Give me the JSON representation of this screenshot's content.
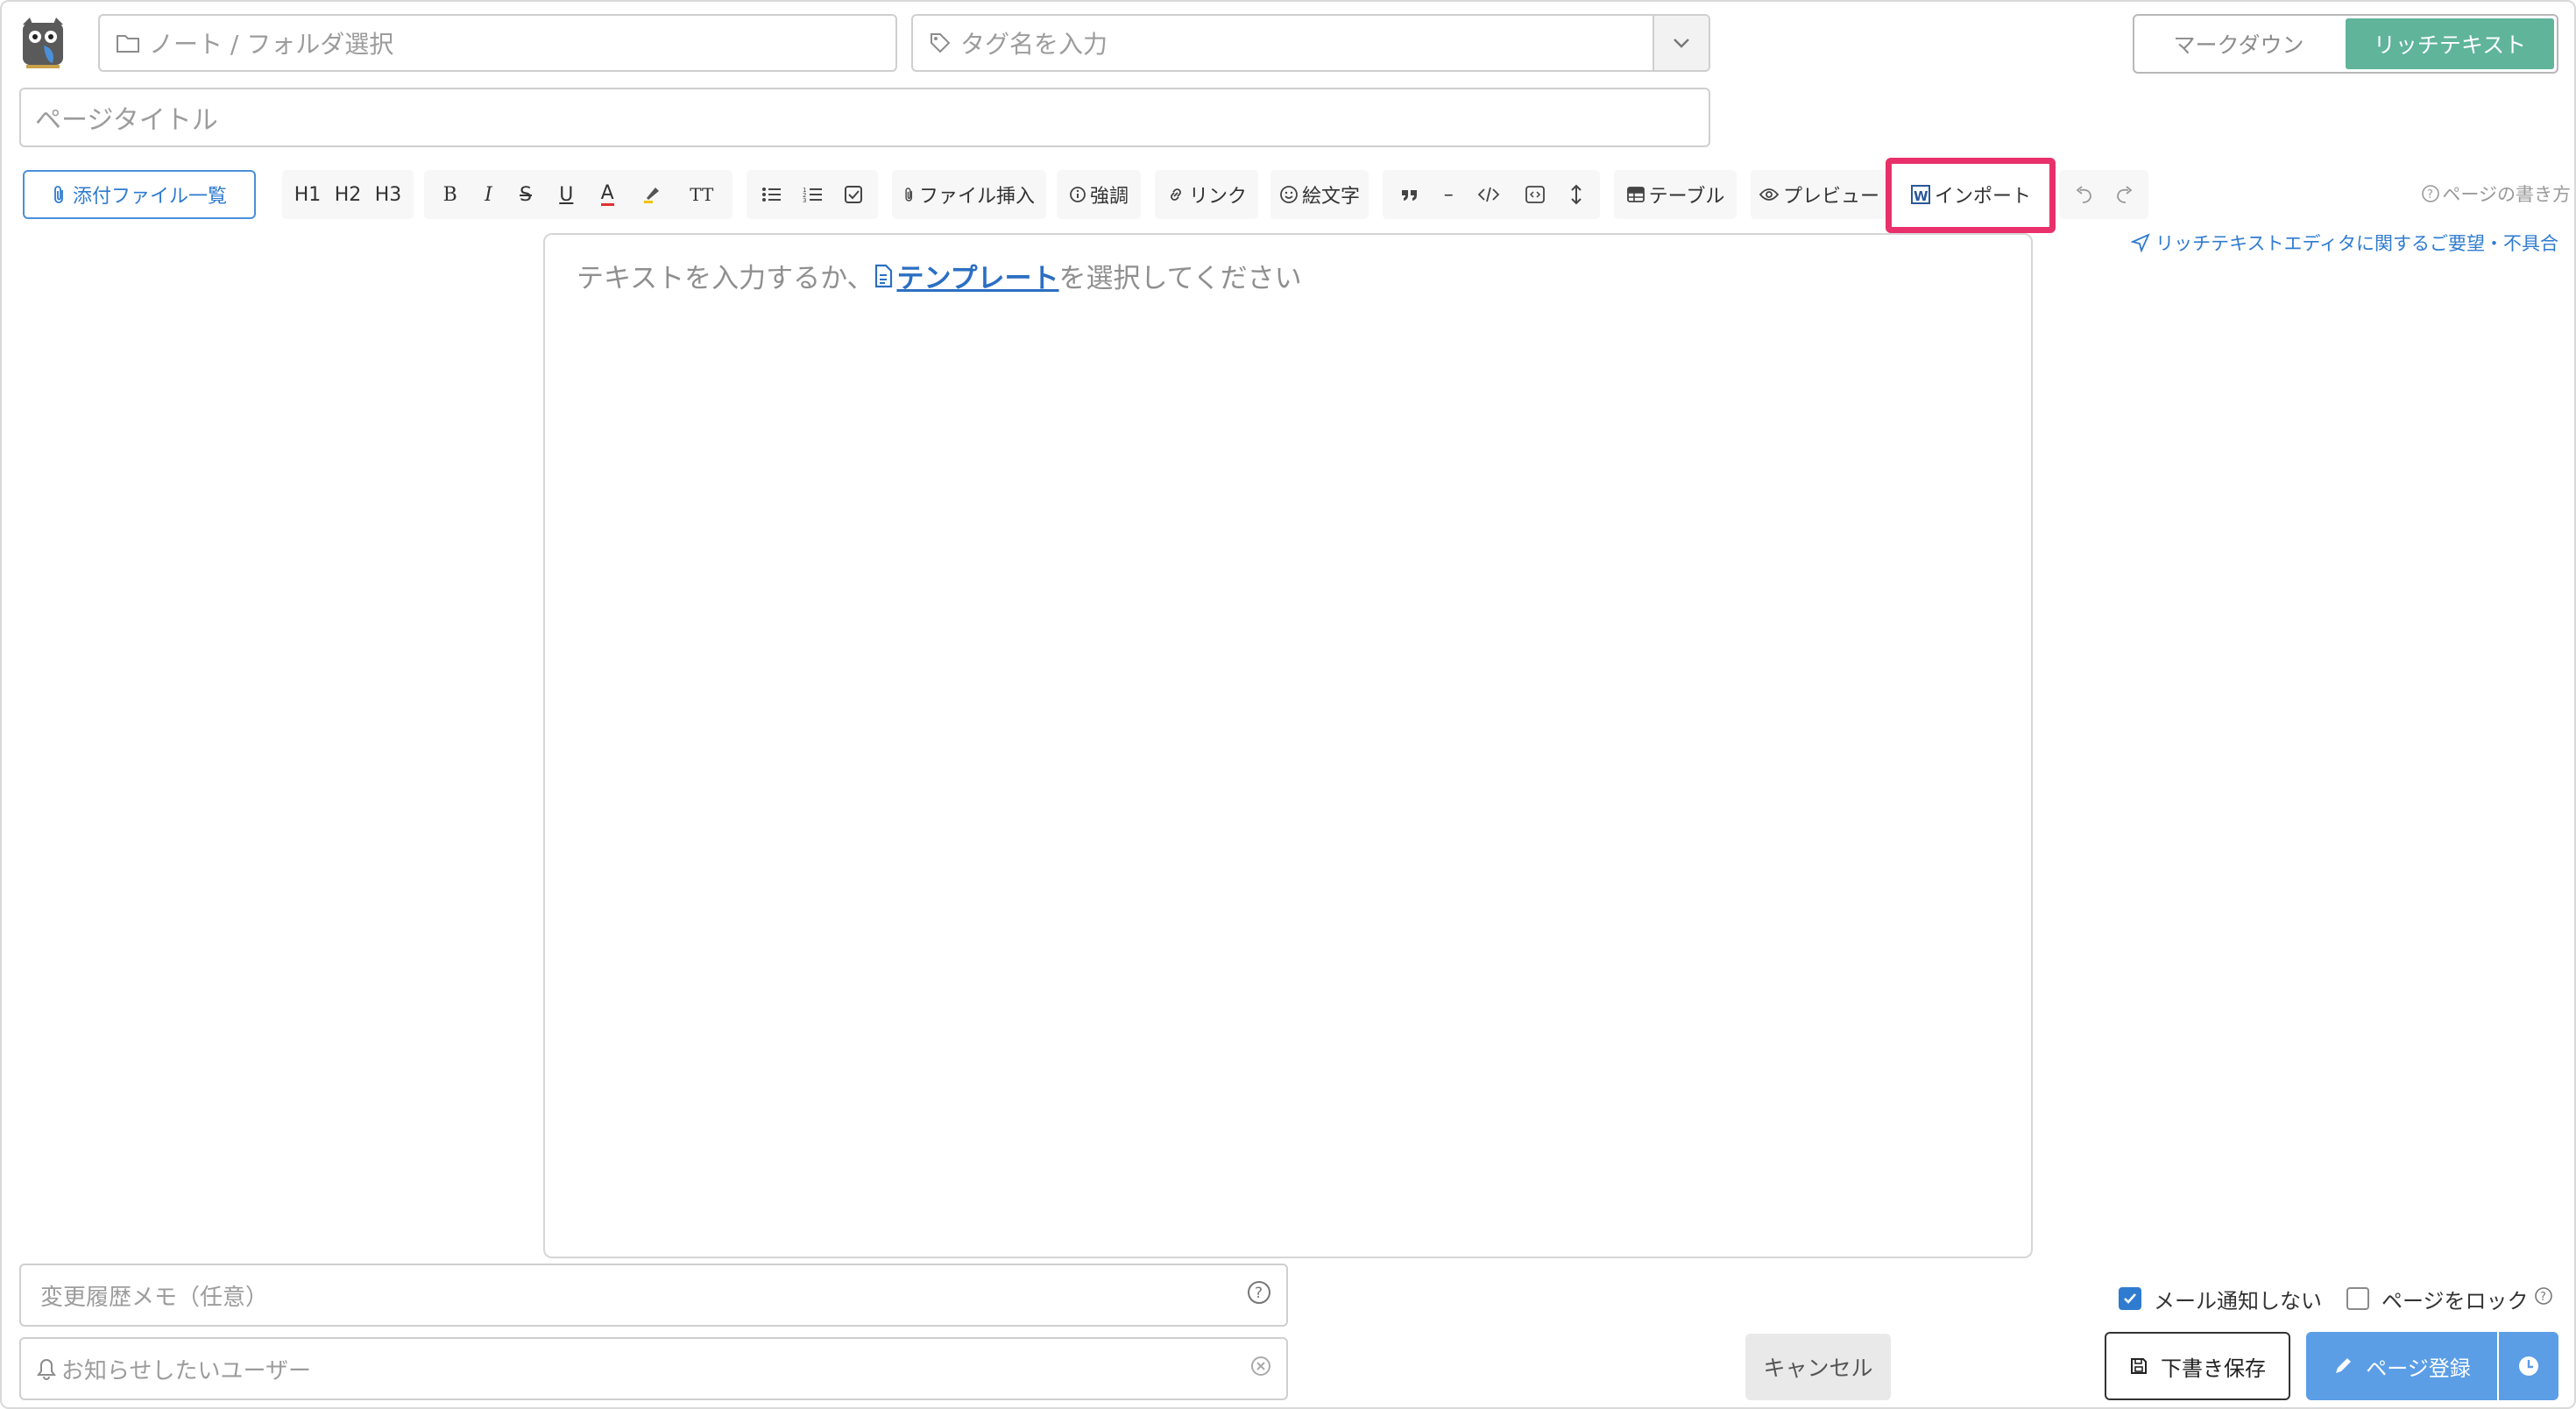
{
  "header": {
    "note_placeholder": "ノート / フォルダ選択",
    "tag_placeholder": "タグ名を入力",
    "title_placeholder": "ページタイトル",
    "mode_markdown": "マークダウン",
    "mode_richtext": "リッチテキスト"
  },
  "toolbar": {
    "attach_label": "添付ファイル一覧",
    "h1": "H1",
    "h2": "H2",
    "h3": "H3",
    "bold": "B",
    "italic": "I",
    "strike": "S",
    "underline": "U",
    "color": "A",
    "fontsize": "TT",
    "file_insert": "ファイル挿入",
    "emphasis": "強調",
    "link": "リンク",
    "emoji": "絵文字",
    "hr": "–",
    "table": "テーブル",
    "preview": "プレビュー",
    "import": "インポート",
    "howto": "ページの書き方",
    "feedback": "リッチテキストエディタに関するご要望・不具合"
  },
  "editor": {
    "placeholder_before": "テキストを入力するか、",
    "template_link": "テンプレート",
    "placeholder_after": "を選択してください"
  },
  "footer": {
    "memo_placeholder": "変更履歴メモ（任意）",
    "notify_placeholder": "お知らせしたいユーザー",
    "cancel": "キャンセル",
    "mail_notify_label": "メール通知しない",
    "mail_notify_checked": true,
    "lock_label": "ページをロック",
    "lock_checked": false,
    "draft_label": "下書き保存",
    "register_label": "ページ登録"
  },
  "colors": {
    "accent_green": "#5fb49a",
    "primary_blue": "#5b9ee6",
    "link_blue": "#2f7bd0",
    "highlight_pink": "#e8316a"
  }
}
